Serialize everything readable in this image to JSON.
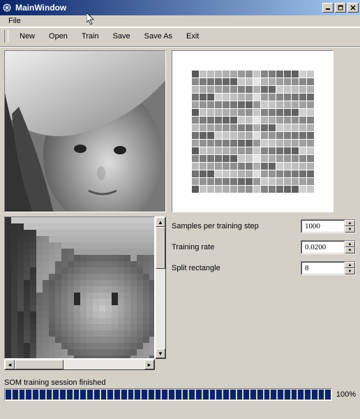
{
  "window": {
    "title": "MainWindow"
  },
  "menu": {
    "file": "File"
  },
  "toolbar": {
    "new": "New",
    "open": "Open",
    "train": "Train",
    "save": "Save",
    "saveas": "Save As",
    "exit": "Exit"
  },
  "params": {
    "samples_label": "Samples per training step",
    "samples_value": "1000",
    "rate_label": "Training rate",
    "rate_value": "0.0200",
    "split_label": "Split rectangle",
    "split_value": "8"
  },
  "status": {
    "text": "SOM training session finished"
  },
  "progress": {
    "percent": "100%"
  }
}
